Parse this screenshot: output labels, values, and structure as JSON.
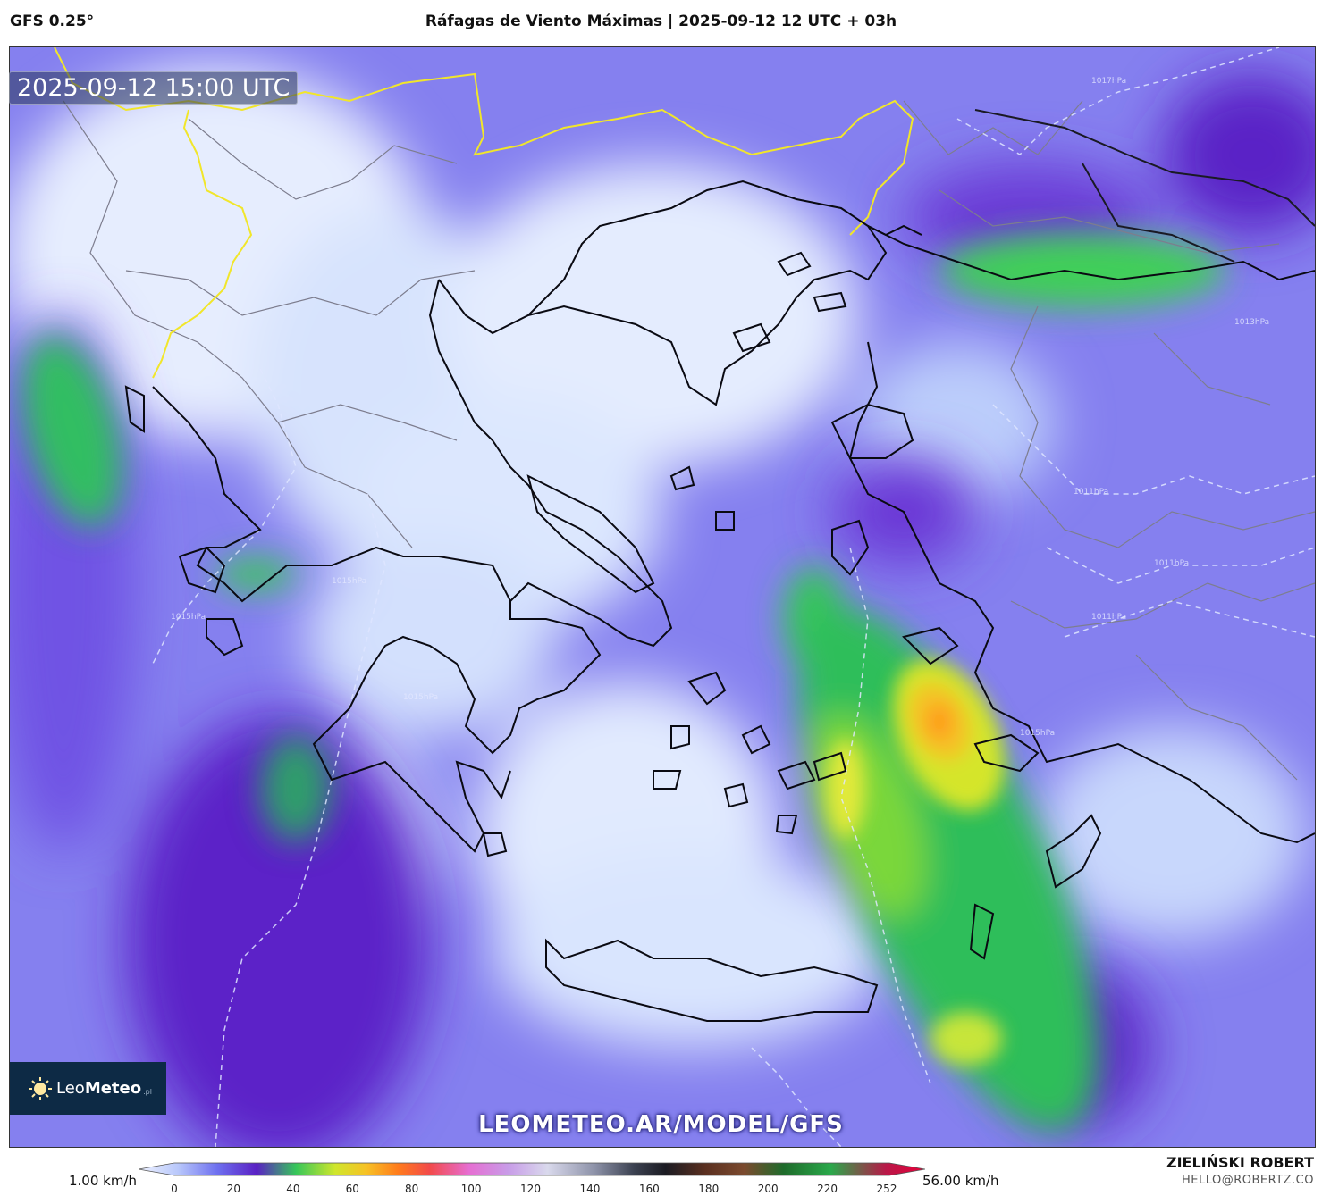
{
  "header": {
    "model": "GFS 0.25°",
    "title": "Ráfagas de Viento Máximas | 2025-09-12 12 UTC + 03h"
  },
  "map": {
    "timestamp": "2025-09-12 15:00 UTC",
    "isobar_labels": [
      "1017hPa",
      "1015hPa",
      "1013hPa",
      "1011hPa",
      "1011hPa",
      "1011hPa",
      "1015hPa",
      "1015hPa",
      "1015hPa"
    ],
    "watermark": "LEOMETEO.AR/MODEL/GFS"
  },
  "logo": {
    "name_light": "Leo",
    "name_bold": "Meteo",
    "suffix": ".pl",
    "icon": "sun-icon"
  },
  "legend": {
    "min_label": "1.00 km/h",
    "max_label": "56.00 km/h",
    "ticks": [
      "0",
      "20",
      "40",
      "60",
      "80",
      "100",
      "120",
      "140",
      "160",
      "180",
      "200",
      "220",
      "252"
    ],
    "colors": [
      "#eef2ff",
      "#b9c8fb",
      "#6e70ef",
      "#5a21c4",
      "#36c65a",
      "#cfe62c",
      "#f7c125",
      "#ff7b1c",
      "#f24a4a",
      "#e66ed2",
      "#c89ce8",
      "#d9d9ec",
      "#8d92a8",
      "#3b4150",
      "#1b1b22",
      "#5a2f20",
      "#7b4a2e",
      "#1e6b2b",
      "#2aa84a",
      "#b81848",
      "#e8003a"
    ]
  },
  "credits": {
    "author": "ZIELIŃSKI ROBERT",
    "email": "HELLO@ROBERTZ.CO"
  }
}
